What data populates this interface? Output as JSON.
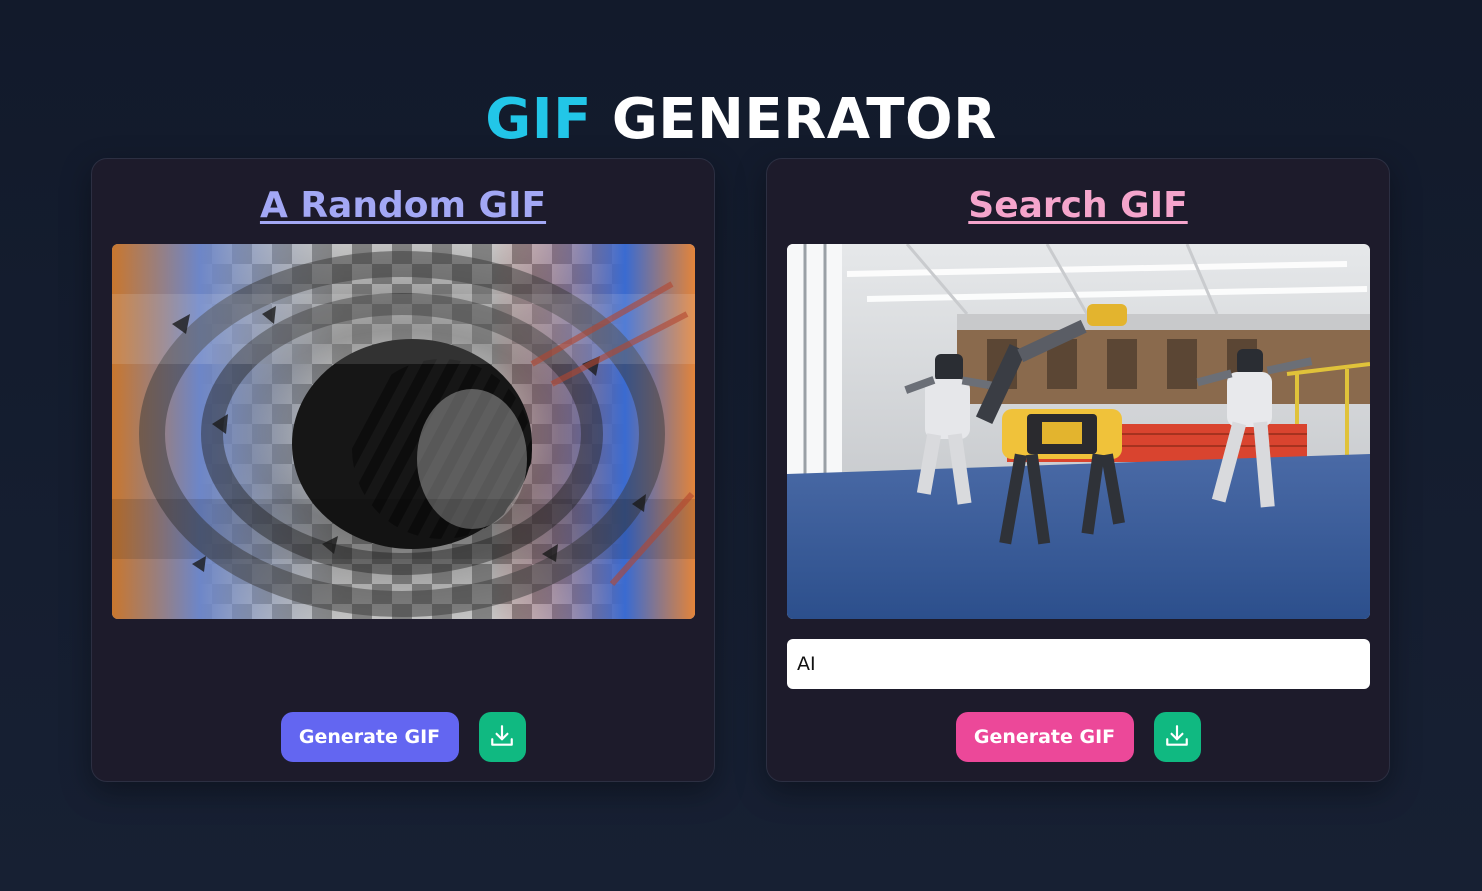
{
  "header": {
    "title_accent": "GIF",
    "title_rest": "GENERATOR"
  },
  "random_card": {
    "title": "A Random GIF",
    "gif_alt": "abstract swirling black and white gif",
    "generate_label": "Generate GIF",
    "download_icon": "download-icon"
  },
  "search_card": {
    "title": "Search GIF",
    "gif_alt": "dancing robots gif",
    "search_value": "AI",
    "generate_label": "Generate GIF",
    "download_icon": "download-icon"
  },
  "colors": {
    "accent_cyan": "#22c6e8",
    "random_accent": "#6366f1",
    "search_accent": "#ec4899",
    "download_green": "#10b981"
  }
}
